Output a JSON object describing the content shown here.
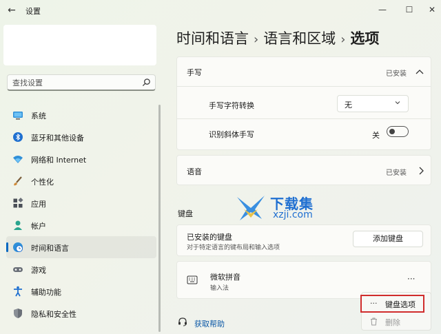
{
  "window": {
    "title": "设置",
    "min_glyph": "—",
    "max_glyph": "☐",
    "close_glyph": "✕",
    "back_glyph": "←"
  },
  "search": {
    "placeholder": "查找设置"
  },
  "sidebar": {
    "items": [
      {
        "label": "系统",
        "icon": "monitor-icon"
      },
      {
        "label": "蓝牙和其他设备",
        "icon": "bluetooth-icon"
      },
      {
        "label": "网络和 Internet",
        "icon": "wifi-icon"
      },
      {
        "label": "个性化",
        "icon": "brush-icon"
      },
      {
        "label": "应用",
        "icon": "apps-icon"
      },
      {
        "label": "帐户",
        "icon": "user-icon"
      },
      {
        "label": "时间和语言",
        "icon": "clock-globe-icon",
        "active": true
      },
      {
        "label": "游戏",
        "icon": "gamepad-icon"
      },
      {
        "label": "辅助功能",
        "icon": "accessibility-icon"
      },
      {
        "label": "隐私和安全性",
        "icon": "shield-icon"
      }
    ]
  },
  "breadcrumb": {
    "part1": "时间和语言",
    "part2": "语言和区域",
    "current": "选项",
    "sep": "›"
  },
  "handwriting": {
    "title": "手写",
    "status": "已安装",
    "char_conv_label": "手写字符转换",
    "char_conv_value": "无",
    "italic_label": "识别斜体手写",
    "italic_state": "关",
    "italic_on": false
  },
  "speech": {
    "title": "语音",
    "status": "已安装"
  },
  "keyboard": {
    "section_title": "键盘",
    "installed_title": "已安装的键盘",
    "installed_desc": "对于特定语言的键布局和输入选项",
    "add_button": "添加键盘",
    "ime_name": "微软拼音",
    "ime_type": "输入法",
    "more_glyph": "···"
  },
  "context_menu": {
    "options_icon": "···",
    "options_label": "键盘选项",
    "delete_label": "删除"
  },
  "help": {
    "label": "获取帮助"
  },
  "watermark": {
    "title": "下载集",
    "url": "xzji.com"
  },
  "colors": {
    "accent": "#0067c0",
    "highlight_border": "#d02c2c",
    "watermark": "#1f6fd1"
  }
}
